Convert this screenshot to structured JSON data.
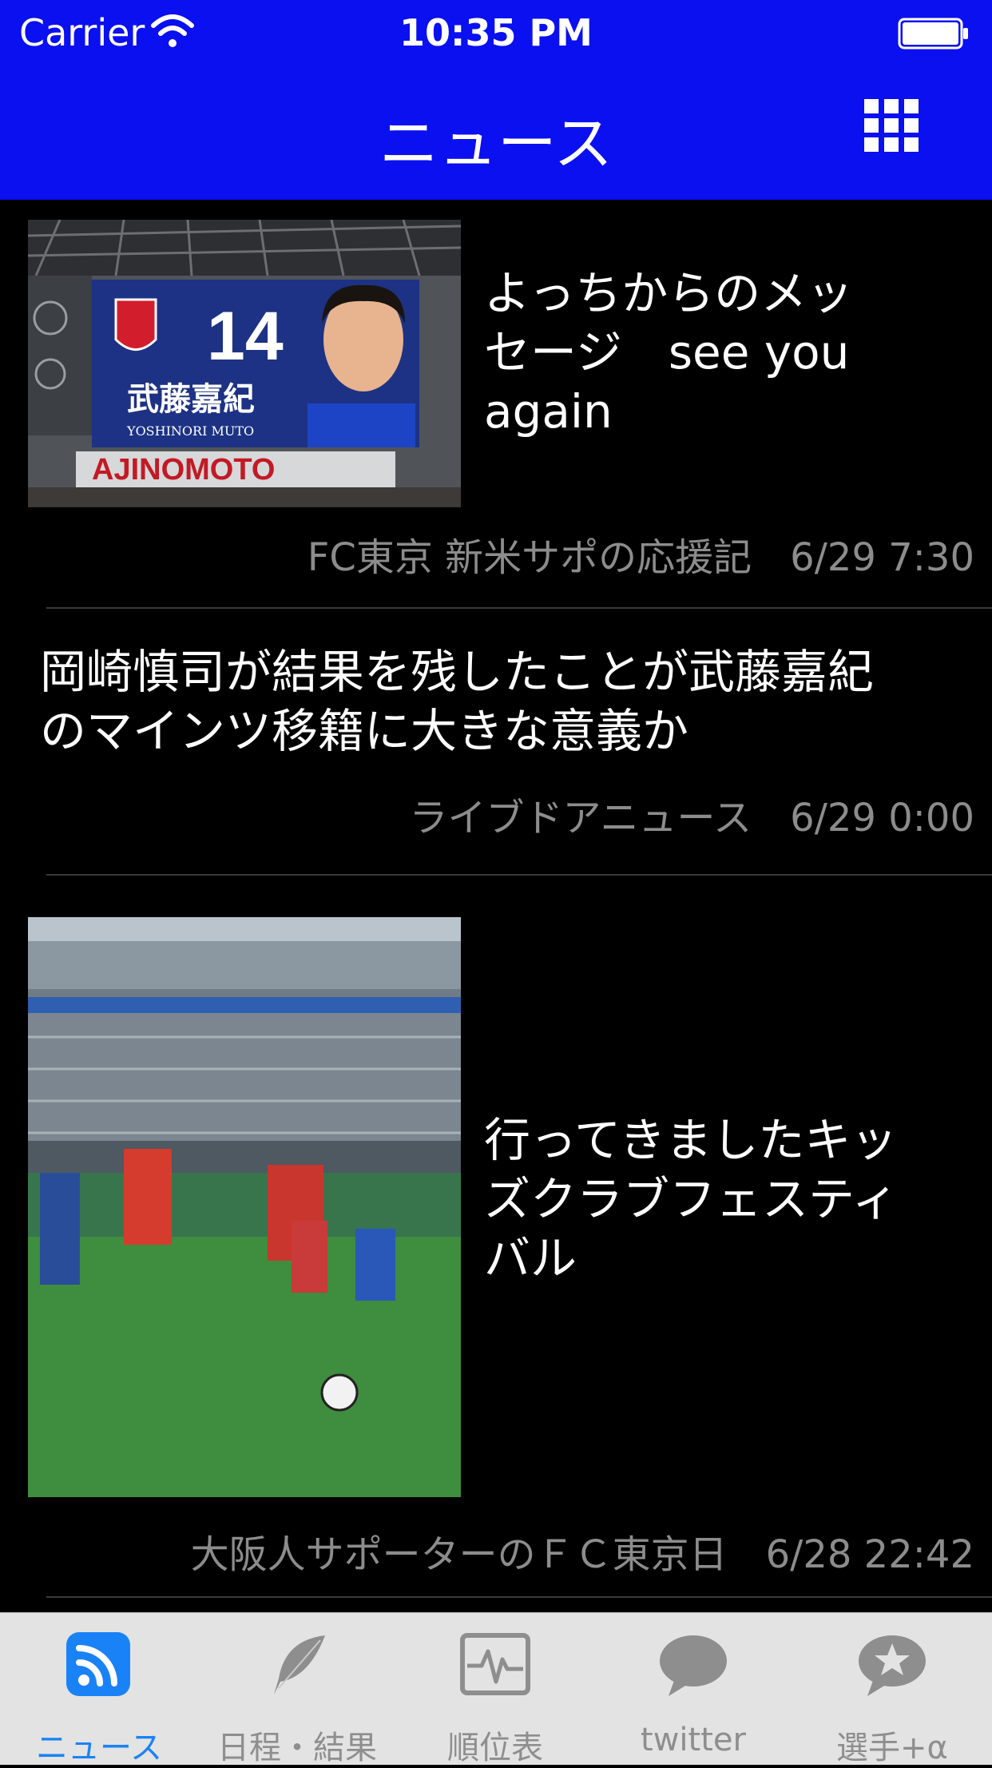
{
  "status_bar": {
    "carrier": "Carrier",
    "time": "10:35 PM"
  },
  "nav": {
    "title": "ニュース",
    "right_icon": "grid-menu-icon"
  },
  "news": [
    {
      "title": "よっちからのメッ\nセージ　see you\nagain",
      "source": "FC東京 新米サポの応援記",
      "date": "6/29 7:30",
      "has_image": true,
      "image": {
        "jersey_number": "14",
        "player_name": "武藤嘉紀",
        "player_name_roman": "YOSHINORI MUTO",
        "banner": "AJINOMOTO"
      }
    },
    {
      "title": "岡崎慎司が結果を残したことが武藤嘉紀\nのマインツ移籍に大きな意義か",
      "source": "ライブドアニュース",
      "date": "6/29 0:00",
      "has_image": false
    },
    {
      "title": "行ってきましたキッ\nズクラブフェスティ\nバル",
      "source": "大阪人サポーターのＦＣ東京日",
      "date": "6/28 22:42",
      "has_image": true
    }
  ],
  "tabs": [
    {
      "label": "ニュース",
      "icon": "rss-icon",
      "active": true
    },
    {
      "label": "日程・結果",
      "icon": "feather-icon",
      "active": false
    },
    {
      "label": "順位表",
      "icon": "chart-pulse-icon",
      "active": false
    },
    {
      "label": "twitter",
      "icon": "speech-bubble-icon",
      "active": false
    },
    {
      "label": "選手+α",
      "icon": "star-bubble-icon",
      "active": false
    }
  ],
  "colors": {
    "nav_bg": "#0a10f0",
    "active_tab": "#1a82f7",
    "meta_text": "#8c8c8c"
  }
}
